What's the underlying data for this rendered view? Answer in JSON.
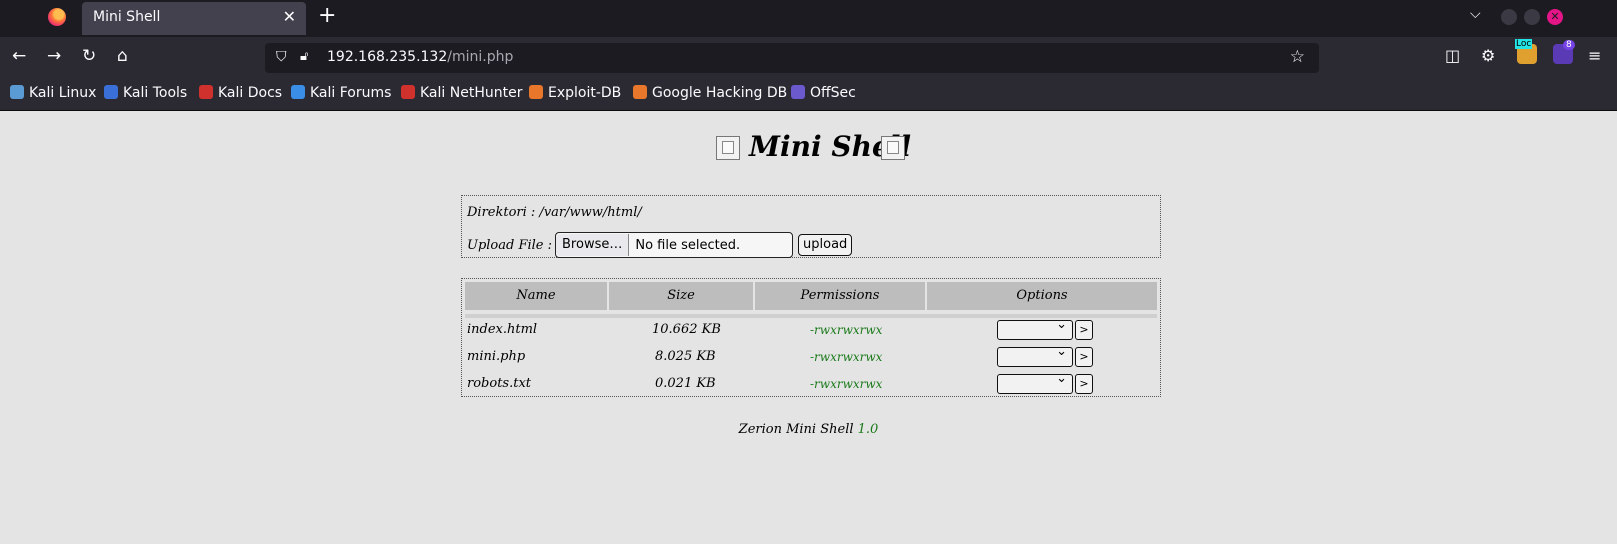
{
  "browser": {
    "tab_title": "Mini Shell",
    "url_host": "192.168.235.132",
    "url_path": "/mini.php",
    "extension_badge": "8",
    "extension_tag": "Loc",
    "bookmarks": [
      {
        "label": "Kali Linux",
        "icon": "kali-dragon-icon",
        "color": "#5b9bd5"
      },
      {
        "label": "Kali Tools",
        "icon": "kali-tools-icon",
        "color": "#3a6fd8"
      },
      {
        "label": "Kali Docs",
        "icon": "kali-docs-icon",
        "color": "#d0312d"
      },
      {
        "label": "Kali Forums",
        "icon": "kali-forums-icon",
        "color": "#3a8ee6"
      },
      {
        "label": "Kali NetHunter",
        "icon": "kali-nethunter-icon",
        "color": "#d0312d"
      },
      {
        "label": "Exploit-DB",
        "icon": "exploit-db-icon",
        "color": "#e8762b"
      },
      {
        "label": "Google Hacking DB",
        "icon": "ghdb-icon",
        "color": "#e8762b"
      },
      {
        "label": "OffSec",
        "icon": "offsec-icon",
        "color": "#6a5acd"
      }
    ]
  },
  "page": {
    "title": "Mini Shell",
    "directory_label": "Direktori : /var/www/html/",
    "upload_label": "Upload File :",
    "browse_label": "Browse…",
    "file_status": "No file selected.",
    "upload_button": "upload",
    "table_headers": [
      "Name",
      "Size",
      "Permissions",
      "Options"
    ],
    "files": [
      {
        "name": "index.html",
        "size": "10.662 KB",
        "permissions": "-rwxrwxrwx",
        "option": ""
      },
      {
        "name": "mini.php",
        "size": "8.025 KB",
        "permissions": "-rwxrwxrwx",
        "option": ""
      },
      {
        "name": "robots.txt",
        "size": "0.021 KB",
        "permissions": "-rwxrwxrwx",
        "option": ""
      }
    ],
    "go_button": ">",
    "footer_text": "Zerion Mini Shell",
    "footer_version": "1.0"
  }
}
